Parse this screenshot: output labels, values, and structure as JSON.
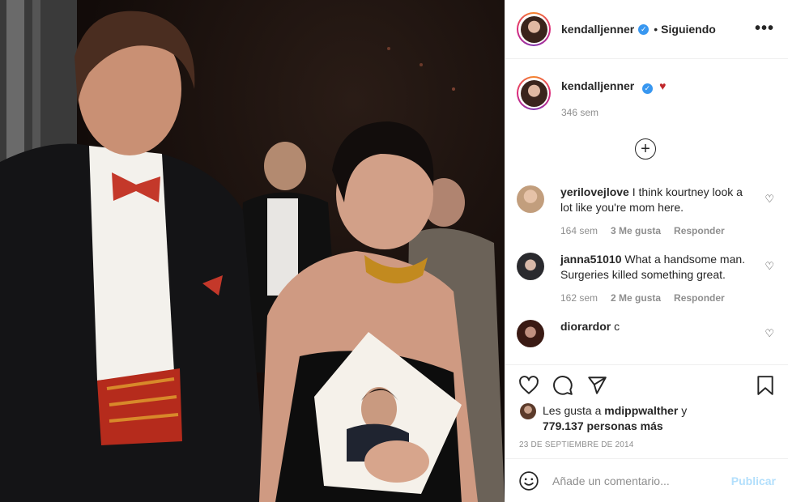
{
  "post": {
    "username": "kendalljenner",
    "follow_status": "Siguiendo",
    "separator": "•",
    "verified_icon": "verified-badge-icon",
    "more_icon": "more-options-icon"
  },
  "caption": {
    "username": "kendalljenner",
    "emoji": "♥",
    "time": "346 sem"
  },
  "load_more": {
    "icon": "plus-circle-icon"
  },
  "comments": [
    {
      "username": "yerilovejlove",
      "text": "I think kourtney look a lot like you're mom here.",
      "time": "164 sem",
      "likes": "3 Me gusta",
      "reply": "Responder"
    },
    {
      "username": "janna51010",
      "text": "What a handsome man. Surgeries killed something great.",
      "time": "162 sem",
      "likes": "2 Me gusta",
      "reply": "Responder"
    },
    {
      "username": "diorardor",
      "text": "c",
      "time": "",
      "likes": "",
      "reply": ""
    }
  ],
  "likes": {
    "prefix": "Les gusta a",
    "user": "mdippwalther",
    "joiner": "y",
    "others": "779.137 personas más"
  },
  "date": "23 DE SEPTIEMBRE DE 2014",
  "comment_box": {
    "placeholder": "Añade un comentario...",
    "publish": "Publicar"
  },
  "colors": {
    "accent": "#3897f0",
    "publish_disabled": "#b2dffc",
    "heart": "#c0282b",
    "muted": "#8e8e8e"
  }
}
